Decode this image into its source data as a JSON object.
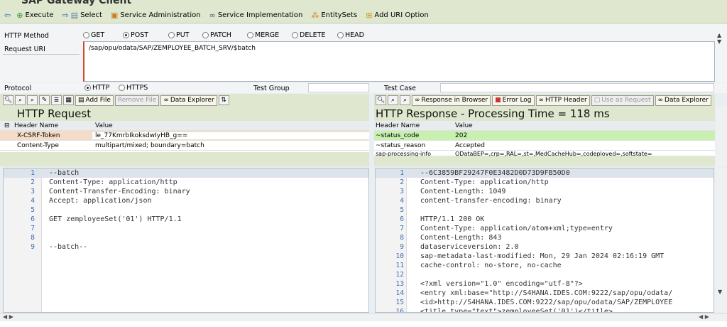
{
  "app": {
    "title": "SAP Gateway Client"
  },
  "toolbar": {
    "execute": "Execute",
    "select": "Select",
    "service_admin": "Service Administration",
    "service_impl": "Service Implementation",
    "entity_sets": "EntitySets",
    "add_uri": "Add URI Option"
  },
  "form": {
    "http_method_label": "HTTP Method",
    "methods": [
      "GET",
      "POST",
      "PUT",
      "PATCH",
      "MERGE",
      "DELETE",
      "HEAD"
    ],
    "selected_method": "POST",
    "request_uri_label": "Request URI",
    "request_uri": "/sap/opu/odata/SAP/ZEMPLOYEE_BATCH_SRV/$batch",
    "protocol_label": "Protocol",
    "protocols": [
      "HTTP",
      "HTTPS"
    ],
    "selected_protocol": "HTTP",
    "test_group_label": "Test Group",
    "test_case_label": "Test Case"
  },
  "request": {
    "add_file": "Add File",
    "remove_file": "Remove File",
    "data_explorer": "Data Explorer",
    "title": "HTTP Request",
    "headers_col1": "Header Name",
    "headers_col2": "Value",
    "headers": [
      {
        "name": "X-CSRF-Token",
        "value": "le_77KmrbIkoksdwIyHB_g=="
      },
      {
        "name": "Content-Type",
        "value": "multipart/mixed; boundary=batch"
      }
    ],
    "body": [
      {
        "n": "1",
        "t": "--batch"
      },
      {
        "n": "2",
        "t": "Content-Type: application/http"
      },
      {
        "n": "3",
        "t": "Content-Transfer-Encoding: binary"
      },
      {
        "n": "4",
        "t": "Accept: application/json"
      },
      {
        "n": "5",
        "t": ""
      },
      {
        "n": "6",
        "t": "GET zemployeeSet('01') HTTP/1.1"
      },
      {
        "n": "7",
        "t": ""
      },
      {
        "n": "8",
        "t": ""
      },
      {
        "n": "9",
        "t": "--batch--"
      }
    ]
  },
  "response": {
    "in_browser": "Response in Browser",
    "error_log": "Error Log",
    "http_header": "HTTP Header",
    "use_as_request": "Use as Request",
    "data_explorer": "Data Explorer",
    "title": "HTTP Response - Processing Time = 118  ms",
    "headers_col1": "Header Name",
    "headers_col2": "Value",
    "headers": [
      {
        "name": "~status_code",
        "value": "202"
      },
      {
        "name": "~status_reason",
        "value": "Accepted"
      },
      {
        "name": "sap-processing-info",
        "value": "ODataBEP=,crp=,RAL=,st=,MedCacheHub=,codeploved=,softstate="
      }
    ],
    "body": [
      {
        "n": "1",
        "t": "--6C3859BF29247F0E3482D0D73D9FB50D0"
      },
      {
        "n": "2",
        "t": "Content-Type: application/http"
      },
      {
        "n": "3",
        "t": "Content-Length: 1049"
      },
      {
        "n": "4",
        "t": "content-transfer-encoding: binary"
      },
      {
        "n": "5",
        "t": ""
      },
      {
        "n": "6",
        "t": "HTTP/1.1 200 OK"
      },
      {
        "n": "7",
        "t": "Content-Type: application/atom+xml;type=entry"
      },
      {
        "n": "8",
        "t": "Content-Length: 843"
      },
      {
        "n": "9",
        "t": "dataserviceversion: 2.0"
      },
      {
        "n": "10",
        "t": "sap-metadata-last-modified: Mon, 29 Jan 2024 02:16:19 GMT"
      },
      {
        "n": "11",
        "t": "cache-control: no-store, no-cache"
      },
      {
        "n": "12",
        "t": ""
      },
      {
        "n": "13",
        "t": "<?xml version=\"1.0\" encoding=\"utf-8\"?>"
      },
      {
        "n": "14",
        "t": "<entry xml:base=\"http://S4HANA.IDES.COM:9222/sap/opu/odata/"
      },
      {
        "n": "15",
        "t": "<id>http://S4HANA.IDES.COM:9222/sap/opu/odata/SAP/ZEMPLOYEE"
      },
      {
        "n": "16",
        "t": "<title type=\"text\">zemployeeSet('01')</title>"
      }
    ]
  },
  "colors": {
    "status_ok": "#c8f0b0",
    "toolbar": "#dfe8cf"
  }
}
